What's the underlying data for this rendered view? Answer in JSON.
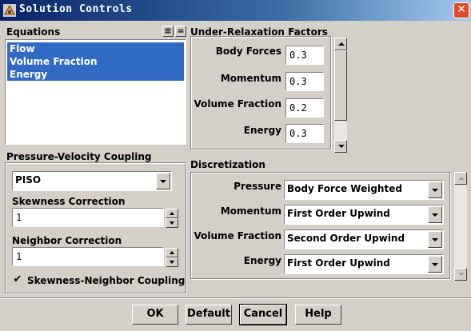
{
  "window": {
    "title": "Solution Controls",
    "close_glyph": "✕"
  },
  "equations": {
    "label": "Equations",
    "items": [
      "Flow",
      "Volume Fraction",
      "Energy"
    ],
    "select_all_glyph": "≡",
    "deselect_all_glyph": "="
  },
  "under_relaxation": {
    "label": "Under-Relaxation Factors",
    "rows": [
      {
        "label": "Body Forces",
        "value": "0.3"
      },
      {
        "label": "Momentum",
        "value": "0.3"
      },
      {
        "label": "Volume Fraction",
        "value": "0.2"
      },
      {
        "label": "Energy",
        "value": "0.3"
      }
    ]
  },
  "pv_coupling": {
    "label": "Pressure-Velocity Coupling",
    "scheme": "PISO",
    "skewness_label": "Skewness Correction",
    "skewness_value": "1",
    "neighbor_label": "Neighbor Correction",
    "neighbor_value": "1",
    "coupling_checkbox_label": "Skewness-Neighbor Coupling",
    "coupling_checked": true
  },
  "discretization": {
    "label": "Discretization",
    "rows": [
      {
        "label": "Pressure",
        "value": "Body Force Weighted"
      },
      {
        "label": "Momentum",
        "value": "First Order Upwind"
      },
      {
        "label": "Volume Fraction",
        "value": "Second Order Upwind"
      },
      {
        "label": "Energy",
        "value": "First Order Upwind"
      }
    ]
  },
  "buttons": {
    "ok": "OK",
    "default": "Default",
    "cancel": "Cancel",
    "help": "Help"
  },
  "colors": {
    "selection": "#316ac5",
    "titlebar": "#0a246a",
    "close": "#e34b2a"
  }
}
